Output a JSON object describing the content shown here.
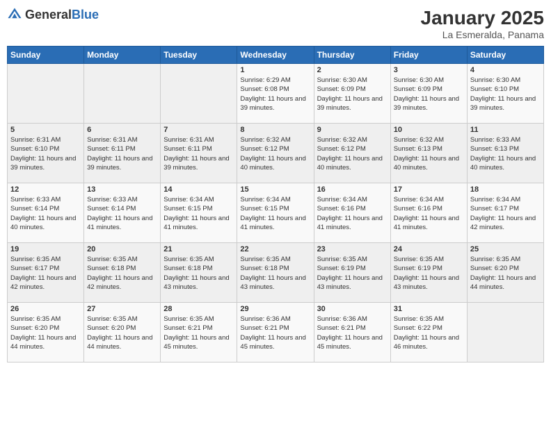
{
  "logo": {
    "general": "General",
    "blue": "Blue"
  },
  "title": "January 2025",
  "subtitle": "La Esmeralda, Panama",
  "weekdays": [
    "Sunday",
    "Monday",
    "Tuesday",
    "Wednesday",
    "Thursday",
    "Friday",
    "Saturday"
  ],
  "weeks": [
    [
      {
        "day": "",
        "info": ""
      },
      {
        "day": "",
        "info": ""
      },
      {
        "day": "",
        "info": ""
      },
      {
        "day": "1",
        "info": "Sunrise: 6:29 AM\nSunset: 6:08 PM\nDaylight: 11 hours and 39 minutes."
      },
      {
        "day": "2",
        "info": "Sunrise: 6:30 AM\nSunset: 6:09 PM\nDaylight: 11 hours and 39 minutes."
      },
      {
        "day": "3",
        "info": "Sunrise: 6:30 AM\nSunset: 6:09 PM\nDaylight: 11 hours and 39 minutes."
      },
      {
        "day": "4",
        "info": "Sunrise: 6:30 AM\nSunset: 6:10 PM\nDaylight: 11 hours and 39 minutes."
      }
    ],
    [
      {
        "day": "5",
        "info": "Sunrise: 6:31 AM\nSunset: 6:10 PM\nDaylight: 11 hours and 39 minutes."
      },
      {
        "day": "6",
        "info": "Sunrise: 6:31 AM\nSunset: 6:11 PM\nDaylight: 11 hours and 39 minutes."
      },
      {
        "day": "7",
        "info": "Sunrise: 6:31 AM\nSunset: 6:11 PM\nDaylight: 11 hours and 39 minutes."
      },
      {
        "day": "8",
        "info": "Sunrise: 6:32 AM\nSunset: 6:12 PM\nDaylight: 11 hours and 40 minutes."
      },
      {
        "day": "9",
        "info": "Sunrise: 6:32 AM\nSunset: 6:12 PM\nDaylight: 11 hours and 40 minutes."
      },
      {
        "day": "10",
        "info": "Sunrise: 6:32 AM\nSunset: 6:13 PM\nDaylight: 11 hours and 40 minutes."
      },
      {
        "day": "11",
        "info": "Sunrise: 6:33 AM\nSunset: 6:13 PM\nDaylight: 11 hours and 40 minutes."
      }
    ],
    [
      {
        "day": "12",
        "info": "Sunrise: 6:33 AM\nSunset: 6:14 PM\nDaylight: 11 hours and 40 minutes."
      },
      {
        "day": "13",
        "info": "Sunrise: 6:33 AM\nSunset: 6:14 PM\nDaylight: 11 hours and 41 minutes."
      },
      {
        "day": "14",
        "info": "Sunrise: 6:34 AM\nSunset: 6:15 PM\nDaylight: 11 hours and 41 minutes."
      },
      {
        "day": "15",
        "info": "Sunrise: 6:34 AM\nSunset: 6:15 PM\nDaylight: 11 hours and 41 minutes."
      },
      {
        "day": "16",
        "info": "Sunrise: 6:34 AM\nSunset: 6:16 PM\nDaylight: 11 hours and 41 minutes."
      },
      {
        "day": "17",
        "info": "Sunrise: 6:34 AM\nSunset: 6:16 PM\nDaylight: 11 hours and 41 minutes."
      },
      {
        "day": "18",
        "info": "Sunrise: 6:34 AM\nSunset: 6:17 PM\nDaylight: 11 hours and 42 minutes."
      }
    ],
    [
      {
        "day": "19",
        "info": "Sunrise: 6:35 AM\nSunset: 6:17 PM\nDaylight: 11 hours and 42 minutes."
      },
      {
        "day": "20",
        "info": "Sunrise: 6:35 AM\nSunset: 6:18 PM\nDaylight: 11 hours and 42 minutes."
      },
      {
        "day": "21",
        "info": "Sunrise: 6:35 AM\nSunset: 6:18 PM\nDaylight: 11 hours and 43 minutes."
      },
      {
        "day": "22",
        "info": "Sunrise: 6:35 AM\nSunset: 6:18 PM\nDaylight: 11 hours and 43 minutes."
      },
      {
        "day": "23",
        "info": "Sunrise: 6:35 AM\nSunset: 6:19 PM\nDaylight: 11 hours and 43 minutes."
      },
      {
        "day": "24",
        "info": "Sunrise: 6:35 AM\nSunset: 6:19 PM\nDaylight: 11 hours and 43 minutes."
      },
      {
        "day": "25",
        "info": "Sunrise: 6:35 AM\nSunset: 6:20 PM\nDaylight: 11 hours and 44 minutes."
      }
    ],
    [
      {
        "day": "26",
        "info": "Sunrise: 6:35 AM\nSunset: 6:20 PM\nDaylight: 11 hours and 44 minutes."
      },
      {
        "day": "27",
        "info": "Sunrise: 6:35 AM\nSunset: 6:20 PM\nDaylight: 11 hours and 44 minutes."
      },
      {
        "day": "28",
        "info": "Sunrise: 6:35 AM\nSunset: 6:21 PM\nDaylight: 11 hours and 45 minutes."
      },
      {
        "day": "29",
        "info": "Sunrise: 6:36 AM\nSunset: 6:21 PM\nDaylight: 11 hours and 45 minutes."
      },
      {
        "day": "30",
        "info": "Sunrise: 6:36 AM\nSunset: 6:21 PM\nDaylight: 11 hours and 45 minutes."
      },
      {
        "day": "31",
        "info": "Sunrise: 6:35 AM\nSunset: 6:22 PM\nDaylight: 11 hours and 46 minutes."
      },
      {
        "day": "",
        "info": ""
      }
    ]
  ]
}
